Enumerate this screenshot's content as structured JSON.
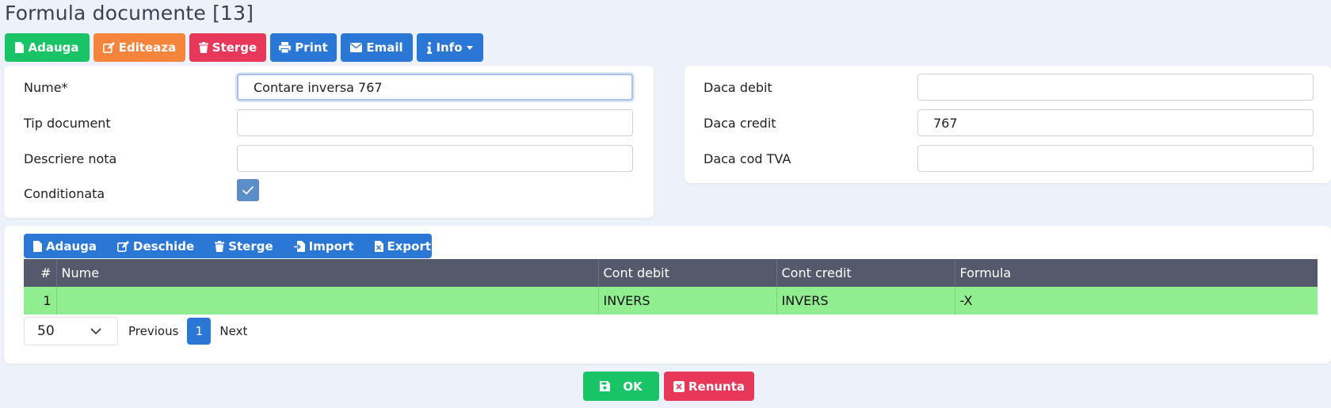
{
  "page": {
    "title": "Formula documente [13]"
  },
  "toolbar": {
    "add": "Adauga",
    "edit": "Editeaza",
    "delete": "Sterge",
    "print": "Print",
    "email": "Email",
    "info": "Info"
  },
  "form_left": {
    "name_label": "Nume*",
    "name_value": "Contare inversa 767",
    "doc_type_label": "Tip document",
    "doc_type_value": "",
    "note_desc_label": "Descriere nota",
    "note_desc_value": "",
    "conditional_label": "Conditionata",
    "conditional_checked": true
  },
  "form_right": {
    "debit_label": "Daca debit",
    "debit_value": "",
    "credit_label": "Daca credit",
    "credit_value": "767",
    "vat_label": "Daca cod TVA",
    "vat_value": ""
  },
  "grid_toolbar": {
    "add": "Adauga",
    "open": "Deschide",
    "delete": "Sterge",
    "import": "Import",
    "export": "Export"
  },
  "table": {
    "columns": [
      "#",
      "Nume",
      "Cont debit",
      "Cont credit",
      "Formula"
    ],
    "rows": [
      [
        "1",
        "",
        "INVERS",
        "INVERS",
        "-X"
      ]
    ]
  },
  "pager": {
    "page_size": "50",
    "previous": "Previous",
    "current": "1",
    "next": "Next"
  },
  "footer": {
    "ok": "OK",
    "cancel": "Renunta"
  },
  "colors": {
    "green": "#19c466",
    "orange": "#f5843c",
    "red": "#e8385a",
    "blue": "#2b77d6",
    "header_dark": "#545a6c",
    "row_highlight": "#90ee90"
  }
}
